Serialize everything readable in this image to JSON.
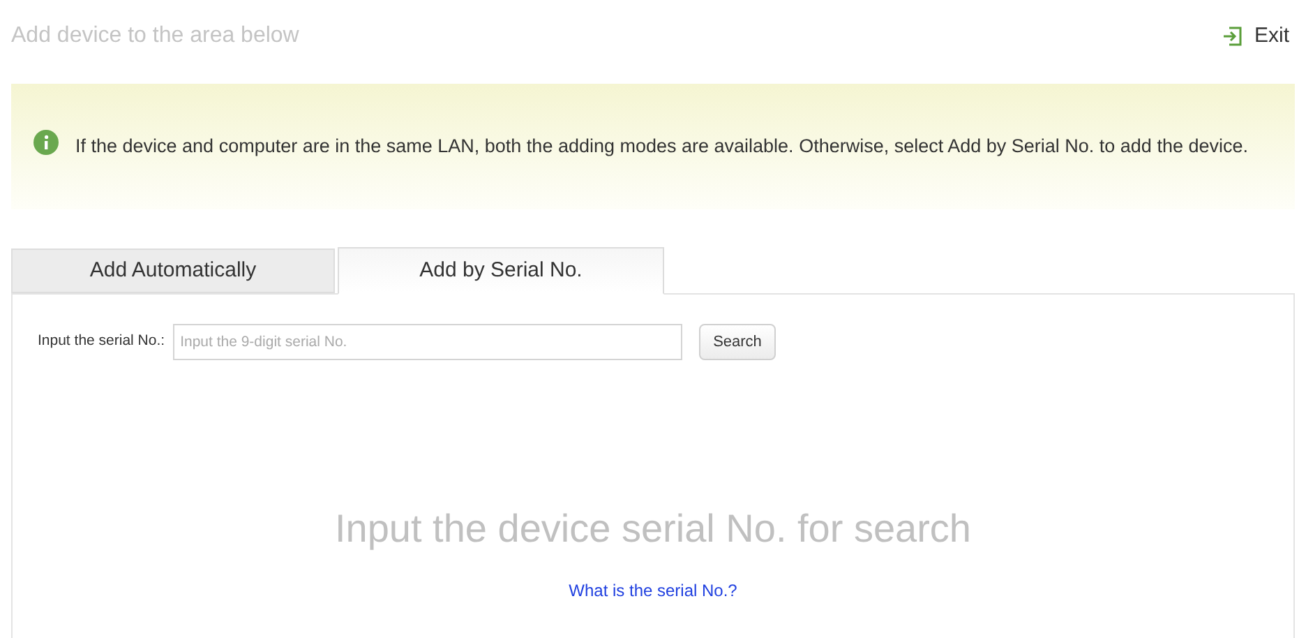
{
  "header": {
    "title": "Add device to the area below",
    "exit_label": "Exit"
  },
  "notice": {
    "text": "If the device and computer are in the same LAN, both the adding modes are available. Otherwise, select Add by Serial No. to add the device."
  },
  "tabs": [
    {
      "label": "Add Automatically",
      "selected": false
    },
    {
      "label": "Add by Serial No.",
      "selected": true
    }
  ],
  "serial_search": {
    "label": "Input the serial No.:",
    "placeholder": "Input the 9-digit serial No.",
    "button": "Search"
  },
  "empty_state": {
    "message": "Input the device serial No. for search",
    "link": "What is the serial No.?"
  }
}
